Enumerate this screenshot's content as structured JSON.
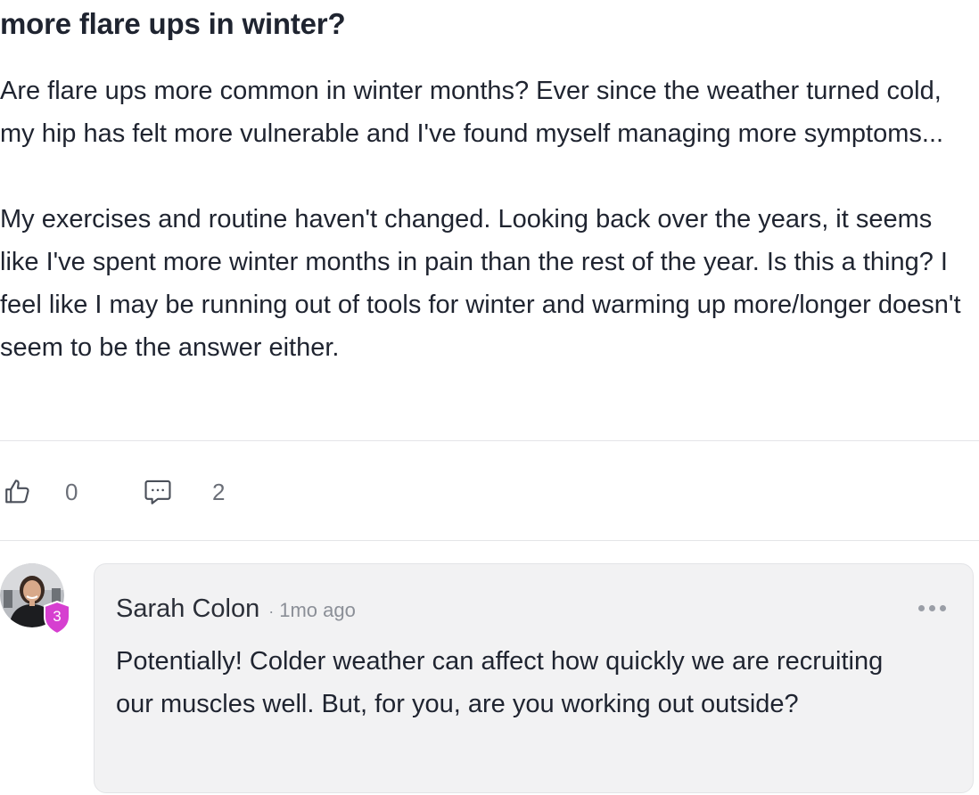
{
  "post": {
    "title": "more flare ups in winter?",
    "paragraphs": [
      "Are flare ups more common in winter months? Ever since the weather turned cold, my hip has felt more vulnerable and I've found myself managing more symptoms...",
      "My exercises and routine haven't changed. Looking back over the years, it seems like I've spent more winter months in pain than the rest of the year. Is this a thing? I feel like I may be running out of tools for winter and warming up more/longer doesn't seem to be the answer either."
    ]
  },
  "actions": {
    "like": {
      "icon": "thumbs-up-icon",
      "count": "0"
    },
    "comment": {
      "icon": "comment-bubble-icon",
      "count": "2"
    }
  },
  "comments": [
    {
      "author": "Sarah Colon",
      "separator": "·",
      "time": "1mo ago",
      "badge_level": "3",
      "badge_color": "#d63fd0",
      "body": "Potentially! Colder weather can affect how quickly we are recruiting our muscles well. But, for you, are you working out outside?",
      "more_icon": "more-horizontal-icon"
    }
  ],
  "colors": {
    "text": "#1f2430",
    "muted": "#6b6f78",
    "card_bg": "#f2f2f3",
    "divider": "#e4e5e8",
    "badge": "#d63fd0"
  }
}
